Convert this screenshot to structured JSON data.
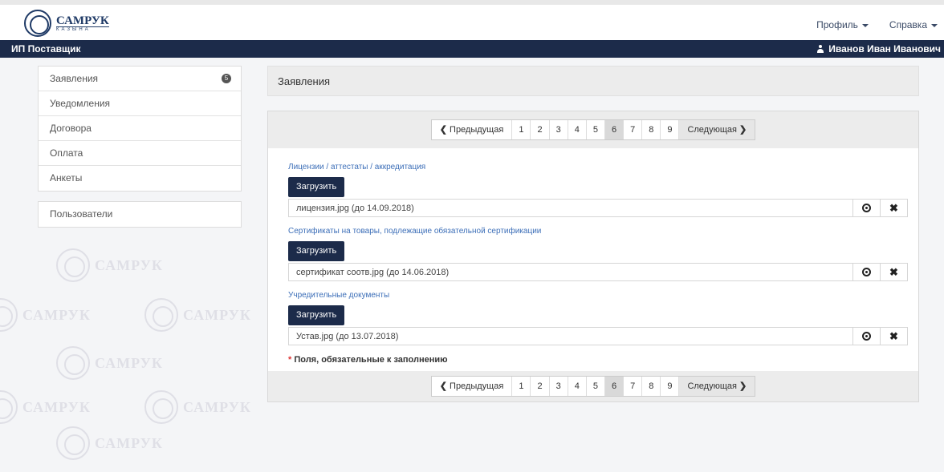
{
  "header": {
    "brand": "САМРУК",
    "brand_sub": "КАЗЫНА",
    "menu": [
      {
        "label": "Профиль"
      },
      {
        "label": "Справка"
      }
    ]
  },
  "navbar": {
    "role": "ИП Поставщик",
    "user": "Иванов Иван Иванович"
  },
  "watermark_text": "САМРУК",
  "sidebar": {
    "items": [
      {
        "label": "Заявления",
        "badge": "5"
      },
      {
        "label": "Уведомления"
      },
      {
        "label": "Договора"
      },
      {
        "label": "Оплата"
      },
      {
        "label": "Анкеты"
      }
    ],
    "users_label": "Пользователи"
  },
  "main": {
    "title": "Заявления",
    "pager": {
      "prev": "Предыдущая",
      "next": "Следующая",
      "pages": [
        "1",
        "2",
        "3",
        "4",
        "5",
        "6",
        "7",
        "8",
        "9"
      ],
      "active": "6"
    },
    "upload_label": "Загрузить",
    "sections": [
      {
        "title": "Лицензии / аттестаты / аккредитация",
        "file": "лицензия.jpg (до 14.09.2018)"
      },
      {
        "title": "Сертификаты на товары, подлежащие обязательной сертификации",
        "file": "сертификат соотв.jpg (до 14.06.2018)"
      },
      {
        "title": "Учредительные документы",
        "file": "Устав.jpg (до 13.07.2018)"
      }
    ],
    "required_star": "*",
    "required_note": "Поля, обязательные к заполнению"
  },
  "colors": {
    "navbar": "#1c2b4a",
    "link": "#3d6fb8",
    "required_star": "#dd3333"
  }
}
